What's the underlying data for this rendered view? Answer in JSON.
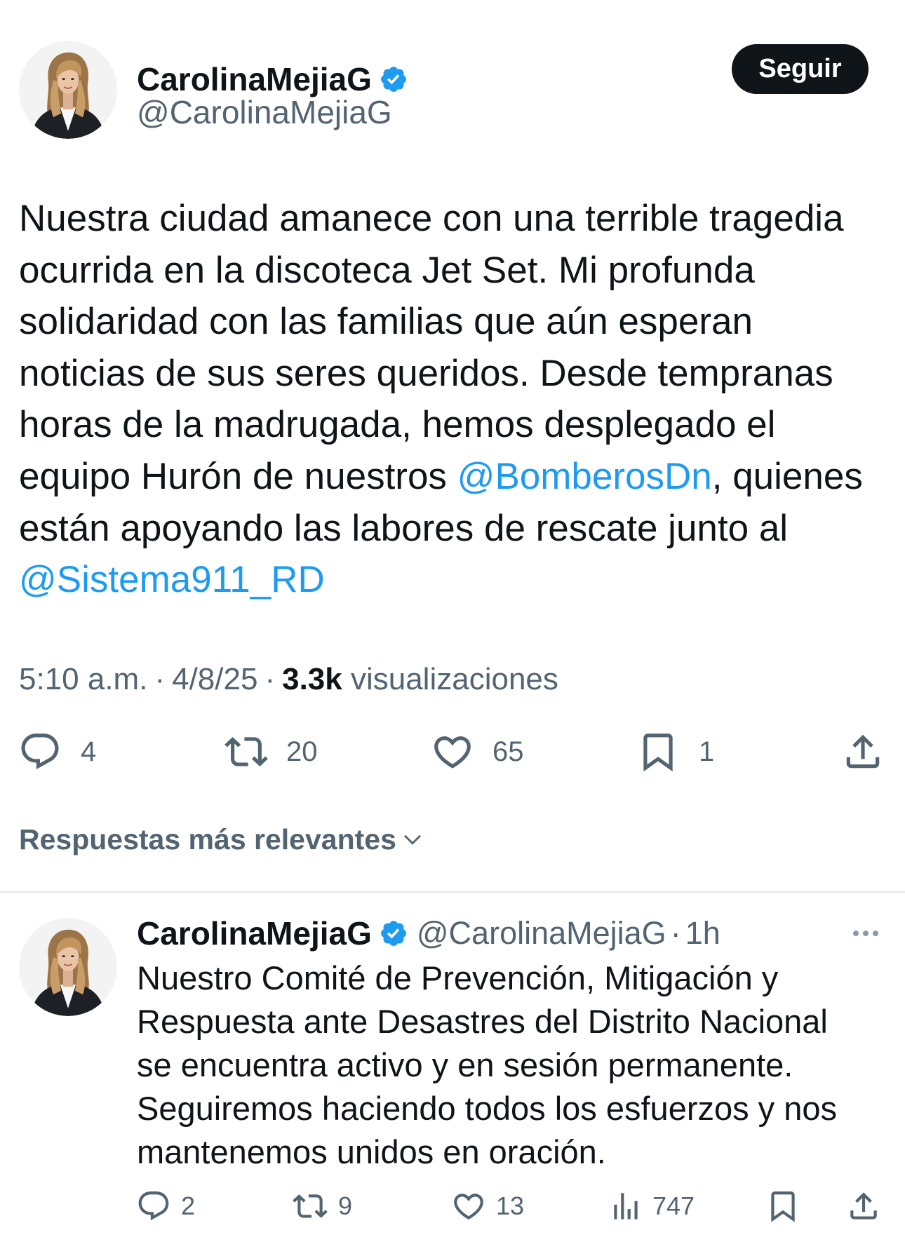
{
  "tweet": {
    "author": {
      "name": "CarolinaMejiaG",
      "handle": "@CarolinaMejiaG",
      "verified": true
    },
    "follow_label": "Seguir",
    "body": {
      "lines": [
        "Nuestra ciudad amanece con una terrible tragedia",
        "ocurrida en la discoteca Jet Set. Mi profunda",
        "solidaridad con las familias que aún esperan",
        "noticias de sus seres queridos. Desde tempranas",
        "horas de la madrugada, hemos desplegado el",
        {
          "before": "equipo Hurón de nuestros ",
          "mention": "@BomberosDn",
          "after": ", quienes"
        },
        "están apoyando las labores de rescate junto al",
        {
          "mention": "@Sistema911_RD"
        }
      ]
    },
    "meta": {
      "time": "5:10 a.m.",
      "separator": "·",
      "date": "4/8/25",
      "views_count": "3.3k",
      "views_label": "visualizaciones"
    },
    "actions": {
      "replies": "4",
      "reposts": "20",
      "likes": "65",
      "bookmarks": "1"
    }
  },
  "replies_sort": {
    "label": "Respuestas más relevantes"
  },
  "reply": {
    "author": {
      "name": "CarolinaMejiaG",
      "handle": "@CarolinaMejiaG",
      "verified": true
    },
    "separator": "·",
    "time": "1h",
    "lines": [
      "Nuestro Comité de Prevención, Mitigación y",
      "Respuesta ante Desastres del Distrito Nacional",
      "se encuentra activo y en sesión permanente.",
      "Seguiremos haciendo todos los esfuerzos y nos",
      "mantenemos unidos en oración."
    ],
    "actions": {
      "replies": "2",
      "reposts": "9",
      "likes": "13",
      "views": "747"
    }
  },
  "icons": {
    "verified": "verified-badge-icon",
    "reply": "reply-icon",
    "repost": "repost-icon",
    "like": "heart-icon",
    "bookmark": "bookmark-icon",
    "share": "share-icon",
    "views": "views-icon",
    "more": "more-icon",
    "chevron": "chevron-down-icon"
  },
  "colors": {
    "text": "#0f1419",
    "secondary": "#536471",
    "link": "#1d9bf0",
    "verified": "#1d9bf0",
    "button_bg": "#0f1419",
    "button_text": "#ffffff",
    "divider": "#e7e9ea"
  }
}
